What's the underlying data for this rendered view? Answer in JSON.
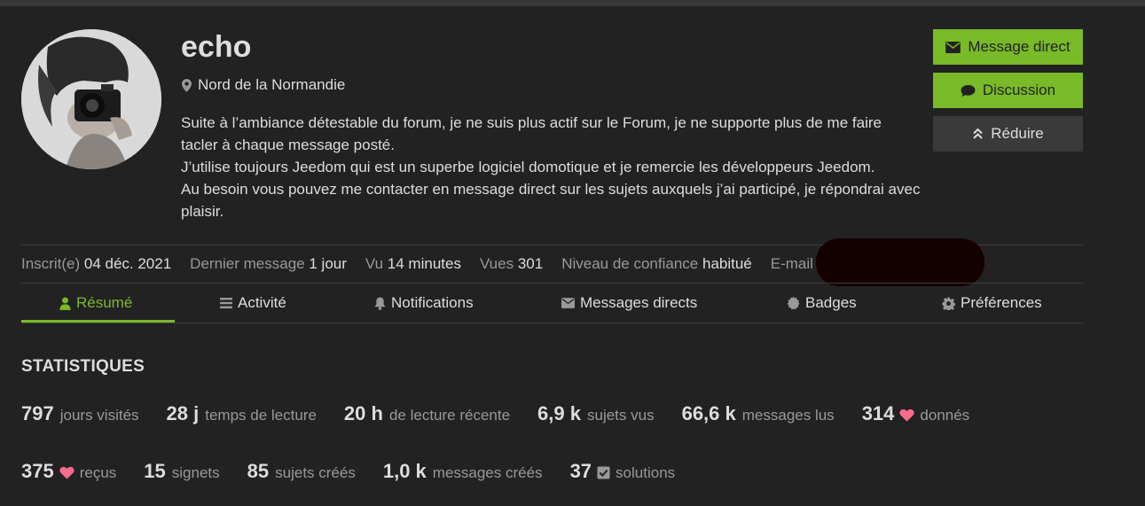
{
  "user": {
    "username": "echo",
    "location": "Nord de la Normandie",
    "bio": [
      "Suite à l’ambiance détestable du forum, je ne suis plus actif sur le Forum, je ne supporte plus de me faire tacler à chaque message posté.",
      "J’utilise toujours Jeedom qui est un superbe logiciel domotique et je remercie les développeurs Jeedom.",
      "Au besoin vous pouvez me contacter en message direct sur les sujets auxquels j’ai participé, je répondrai avec plaisir."
    ]
  },
  "actions": {
    "message_direct": "Message direct",
    "discussion": "Discussion",
    "reduire": "Réduire"
  },
  "meta": {
    "inscrit_label": "Inscrit(e)",
    "inscrit_value": "04 déc. 2021",
    "dernier_label": "Dernier message",
    "dernier_value": "1 jour",
    "vu_label": "Vu",
    "vu_value": "14 minutes",
    "vues_label": "Vues",
    "vues_value": "301",
    "confiance_label": "Niveau de confiance",
    "confiance_value": "habitué",
    "email_label": "E-mail"
  },
  "tabs": [
    {
      "label": "Résumé",
      "icon": "user-icon",
      "active": true
    },
    {
      "label": "Activité",
      "icon": "bars-icon",
      "active": false
    },
    {
      "label": "Notifications",
      "icon": "bell-icon",
      "active": false
    },
    {
      "label": "Messages directs",
      "icon": "envelope-icon",
      "active": false
    },
    {
      "label": "Badges",
      "icon": "certificate-icon",
      "active": false
    },
    {
      "label": "Préférences",
      "icon": "cog-icon",
      "active": false
    }
  ],
  "stats": {
    "title": "STATISTIQUES",
    "row1": [
      {
        "num": "797",
        "label": "jours visités"
      },
      {
        "num": "28 j",
        "label": "temps de lecture"
      },
      {
        "num": "20 h",
        "label": "de lecture récente"
      },
      {
        "num": "6,9 k",
        "label": "sujets vus"
      },
      {
        "num": "66,6 k",
        "label": "messages lus"
      },
      {
        "num": "314",
        "label": "donnés",
        "icon": "heart-icon"
      }
    ],
    "row2": [
      {
        "num": "375",
        "label": "reçus",
        "icon": "heart-icon"
      },
      {
        "num": "15",
        "label": "signets"
      },
      {
        "num": "85",
        "label": "sujets créés"
      },
      {
        "num": "1,0 k",
        "label": "messages créés"
      },
      {
        "num": "37",
        "label": "solutions",
        "icon": "check-square-icon"
      }
    ]
  },
  "colors": {
    "accent": "#79ba28",
    "heart": "#fa6c8d",
    "background": "#222222"
  }
}
